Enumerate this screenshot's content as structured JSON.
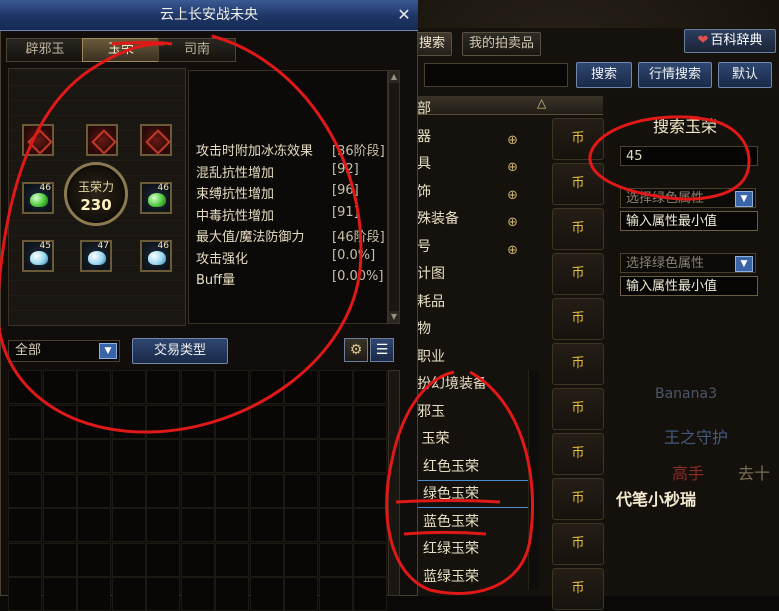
{
  "window": {
    "title": "云上长安战未央",
    "close_glyph": "✕",
    "tabs": [
      {
        "label": "辟邪玉",
        "active": false
      },
      {
        "label": "玉荣",
        "active": true
      },
      {
        "label": "司南",
        "active": false
      }
    ]
  },
  "gem_panel": {
    "ring_label": "玉荣力",
    "ring_value": "230",
    "slots": [
      {
        "type": "red"
      },
      {
        "type": "red"
      },
      {
        "type": "red"
      },
      {
        "type": "green",
        "level": "46"
      },
      {
        "type": "green",
        "level": "46"
      },
      {
        "type": "blue",
        "level": "45"
      },
      {
        "type": "blue",
        "level": "47"
      },
      {
        "type": "blue",
        "level": "46"
      }
    ]
  },
  "stats": [
    {
      "name": "攻击时附加冰冻效果",
      "value": "[36阶段]"
    },
    {
      "name": "混乱抗性增加",
      "value": "[92]"
    },
    {
      "name": "束缚抗性增加",
      "value": "[96]"
    },
    {
      "name": "中毒抗性增加",
      "value": "[91]"
    },
    {
      "name": "最大值/魔法防御力",
      "value": "[46阶段]"
    },
    {
      "name": "攻击强化",
      "value": "[0.0%]"
    },
    {
      "name": "Buff量",
      "value": "[0.00%]"
    }
  ],
  "filter": {
    "selected": "全部",
    "trade_type_button": "交易类型",
    "settings_icon": "gear-icon",
    "list_icon": "list-icon"
  },
  "auction": {
    "tabs": [
      {
        "label": "物品搜索",
        "active": true
      },
      {
        "label": "我的拍卖品",
        "active": false
      }
    ],
    "encyclopedia_button": "百科辞典",
    "search_button": "搜索",
    "market_search_button": "行情搜索",
    "default_button": "默认",
    "price_sort_glyph": "△",
    "categories": [
      {
        "label": "全部",
        "zoom": false,
        "sub": false
      },
      {
        "label": "武器",
        "zoom": true,
        "sub": false
      },
      {
        "label": "防具",
        "zoom": true,
        "sub": false
      },
      {
        "label": "首饰",
        "zoom": true,
        "sub": false
      },
      {
        "label": "特殊装备",
        "zoom": true,
        "sub": false
      },
      {
        "label": "称号",
        "zoom": true,
        "sub": false
      },
      {
        "label": "设计图",
        "zoom": false,
        "sub": false
      },
      {
        "label": "消耗品",
        "zoom": false,
        "sub": false
      },
      {
        "label": "宠物",
        "zoom": false,
        "sub": false
      },
      {
        "label": "副职业",
        "zoom": false,
        "sub": false
      },
      {
        "label": "装扮幻境装备",
        "zoom": false,
        "sub": false
      },
      {
        "label": "辟邪玉",
        "zoom": false,
        "sub": false
      },
      {
        "label": "日 玉荣",
        "zoom": false,
        "sub": false
      },
      {
        "label": "红色玉荣",
        "zoom": false,
        "sub": true
      },
      {
        "label": "绿色玉荣",
        "zoom": false,
        "sub": true,
        "selected": true
      },
      {
        "label": "蓝色玉荣",
        "zoom": false,
        "sub": true
      },
      {
        "label": "红绿玉荣",
        "zoom": false,
        "sub": true
      },
      {
        "label": "蓝绿玉荣",
        "zoom": false,
        "sub": true
      }
    ],
    "price_labels": [
      "币",
      "币",
      "币",
      "币",
      "币",
      "币",
      "币",
      "币",
      "币",
      "币",
      "币"
    ],
    "right_panel": {
      "title": "搜索玉荣",
      "search_value": "45",
      "select1_placeholder": "选择绿色属性",
      "min1_placeholder": "输入属性最小值",
      "select2_placeholder": "选择绿色属性",
      "min2_placeholder": "输入属性最小值"
    },
    "background_texts": [
      "Banana3",
      "王之守护",
      "高手",
      "去十",
      "代笔小秒瑞"
    ]
  },
  "colors": {
    "annotation": "#e01818",
    "title_bar": "#1d3566",
    "gold": "#e8c040"
  }
}
